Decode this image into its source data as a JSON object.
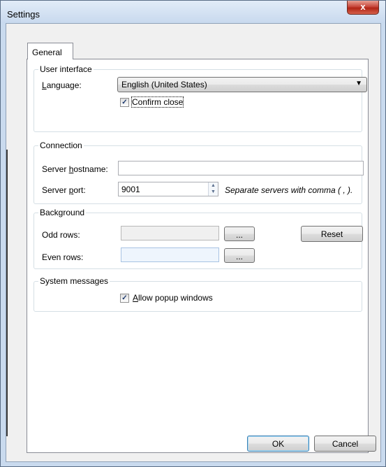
{
  "window": {
    "title": "Settings",
    "close_label": "x"
  },
  "tabs": [
    {
      "label": "General"
    }
  ],
  "user_interface": {
    "title": "User interface",
    "language_label": "Language:",
    "language_value": "English (United States)",
    "confirm_close_label": "Confirm close",
    "confirm_close_checked": true
  },
  "connection": {
    "title": "Connection",
    "hostname_label": "Server hostname:",
    "hostname_value": "",
    "port_label": "Server port:",
    "port_value": "9001",
    "hint": "Separate servers with comma ( , )."
  },
  "background": {
    "title": "Background",
    "odd_label": "Odd rows:",
    "even_label": "Even rows:",
    "browse_label": "...",
    "reset_label": "Reset"
  },
  "system_messages": {
    "title": "System messages",
    "popup_label": "Allow popup windows",
    "popup_checked": true
  },
  "footer": {
    "ok_label": "OK",
    "cancel_label": "Cancel"
  },
  "colors": {
    "title_bar": "#d3e2f3",
    "accent": "#3c7fb1",
    "close": "#c7463a"
  }
}
